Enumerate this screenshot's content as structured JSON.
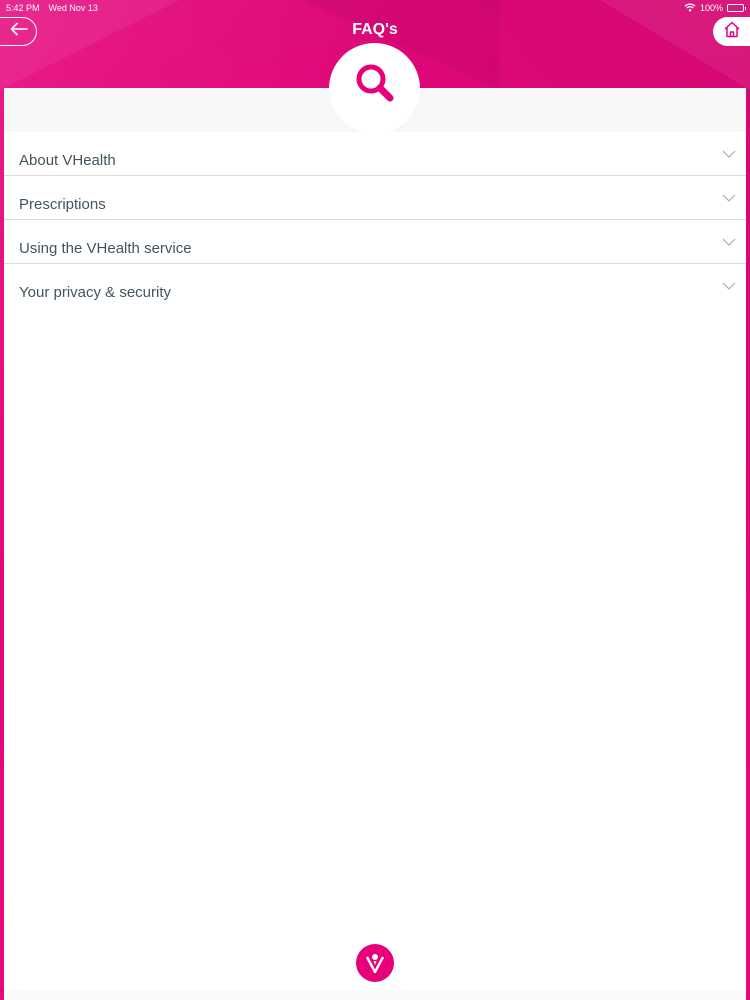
{
  "status_bar": {
    "time": "5:42 PM",
    "date": "Wed Nov 13",
    "battery": "100%",
    "icons": [
      "wifi-icon",
      "battery-icon"
    ]
  },
  "header": {
    "title": "FAQ's",
    "back_icon": "arrow-left-icon",
    "home_icon": "home-icon",
    "badge_icon": "search-icon"
  },
  "faq": {
    "items": [
      {
        "label": "About VHealth",
        "icon": "chevron-down-icon"
      },
      {
        "label": "Prescriptions",
        "icon": "chevron-down-icon"
      },
      {
        "label": "Using the VHealth service",
        "icon": "chevron-down-icon"
      },
      {
        "label": "Your privacy & security",
        "icon": "chevron-down-icon"
      }
    ]
  },
  "footer": {
    "logo_icon": "vhealth-logo-icon"
  },
  "colors": {
    "brand": "#e6007a",
    "text": "#44545e",
    "divider": "#dcdcdc"
  }
}
